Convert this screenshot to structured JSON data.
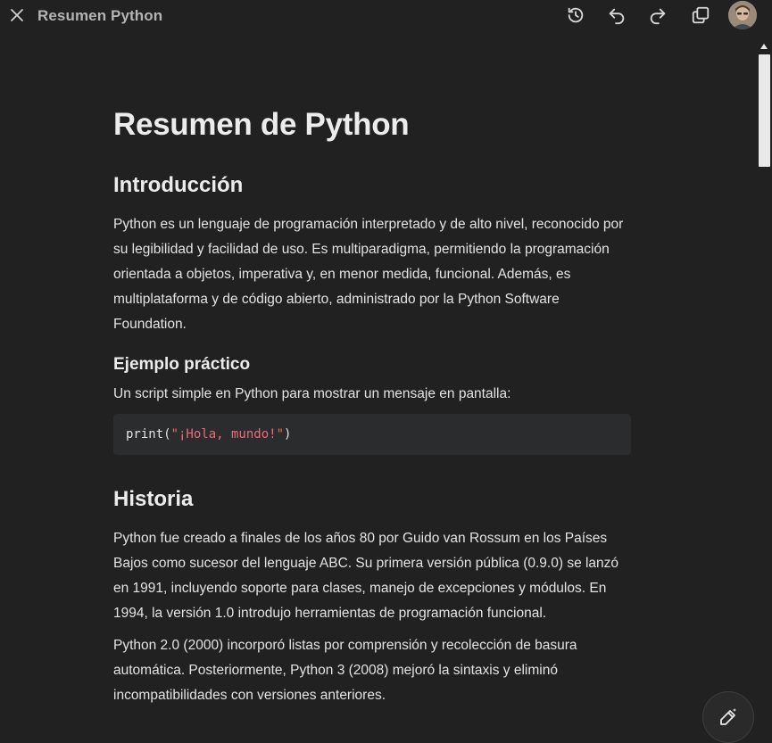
{
  "header": {
    "title": "Resumen Python",
    "close_icon": "close-icon",
    "history_icon": "history-icon",
    "undo_icon": "undo-icon",
    "redo_icon": "redo-icon",
    "copy_icon": "copy-icon"
  },
  "document": {
    "title": "Resumen de Python",
    "intro": {
      "heading": "Introducción",
      "paragraph": "Python es un lenguaje de programación interpretado y de alto nivel, reconocido por su legibilidad y facilidad de uso. Es multiparadigma, permitiendo la programación orientada a objetos, imperativa y, en menor medida, funcional. Además, es multiplataforma y de código abierto, administrado por la Python Software Foundation."
    },
    "example": {
      "heading": "Ejemplo práctico",
      "paragraph": "Un script simple en Python para mostrar un mensaje en pantalla:",
      "code_func": "print(",
      "code_string": "\"¡Hola, mundo!\"",
      "code_close": ")"
    },
    "history": {
      "heading": "Historia",
      "paragraph1": "Python fue creado a finales de los años 80 por Guido van Rossum en los Países Bajos como sucesor del lenguaje ABC. Su primera versión pública (0.9.0) se lanzó en 1991, incluyendo soporte para clases, manejo de excepciones y módulos. En 1994, la versión 1.0 introdujo herramientas de programación funcional.",
      "paragraph2": "Python 2.0 (2000) incorporó listas por comprensión y recolección de basura automática. Posteriormente, Python 3 (2008) mejoró la sintaxis y eliminó incompatibilidades con versiones anteriores."
    }
  },
  "colors": {
    "background": "#212121",
    "code_background": "#2a2c2e",
    "code_string": "#ef6b73"
  },
  "fab": {
    "icon": "edit-pencil-icon"
  }
}
